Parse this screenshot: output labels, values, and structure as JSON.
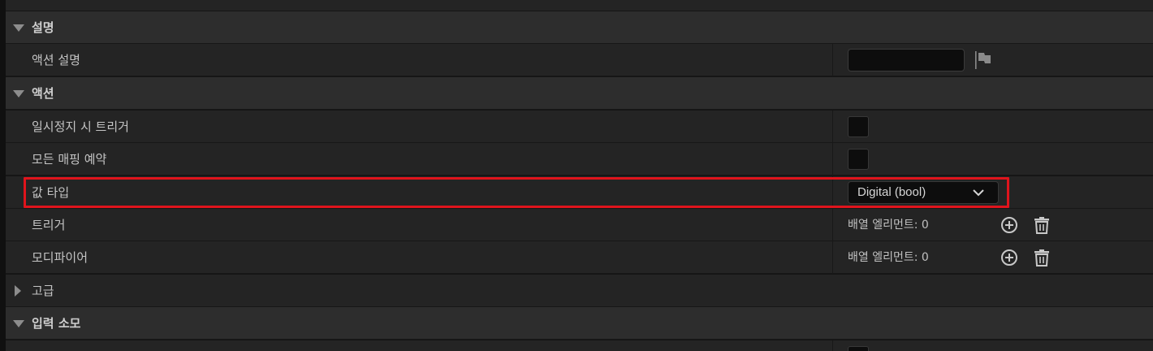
{
  "sections": {
    "description": {
      "title": "설명",
      "action_description_label": "액션 설명",
      "action_description_value": ""
    },
    "action": {
      "title": "액션",
      "trigger_when_paused_label": "일시정지 시 트리거",
      "trigger_when_paused_checked": false,
      "reserve_all_mappings_label": "모든 매핑 예약",
      "reserve_all_mappings_checked": false,
      "value_type_label": "값 타입",
      "value_type_selected": "Digital (bool)",
      "triggers_label": "트리거",
      "triggers_array": "배열 엘리먼트: 0",
      "modifiers_label": "모디파이어",
      "modifiers_array": "배열 엘리먼트: 0"
    },
    "advanced": {
      "title": "고급"
    },
    "input_consumption": {
      "title": "입력 소모"
    }
  },
  "colors": {
    "highlight": "#e0141c",
    "row_bg": "#242424",
    "category_bg": "#2d2d2d"
  },
  "icons": [
    "flag-icon",
    "chevron-down-icon",
    "add-element-icon",
    "delete-icon",
    "expand-arrow-icon",
    "collapse-arrow-icon"
  ]
}
